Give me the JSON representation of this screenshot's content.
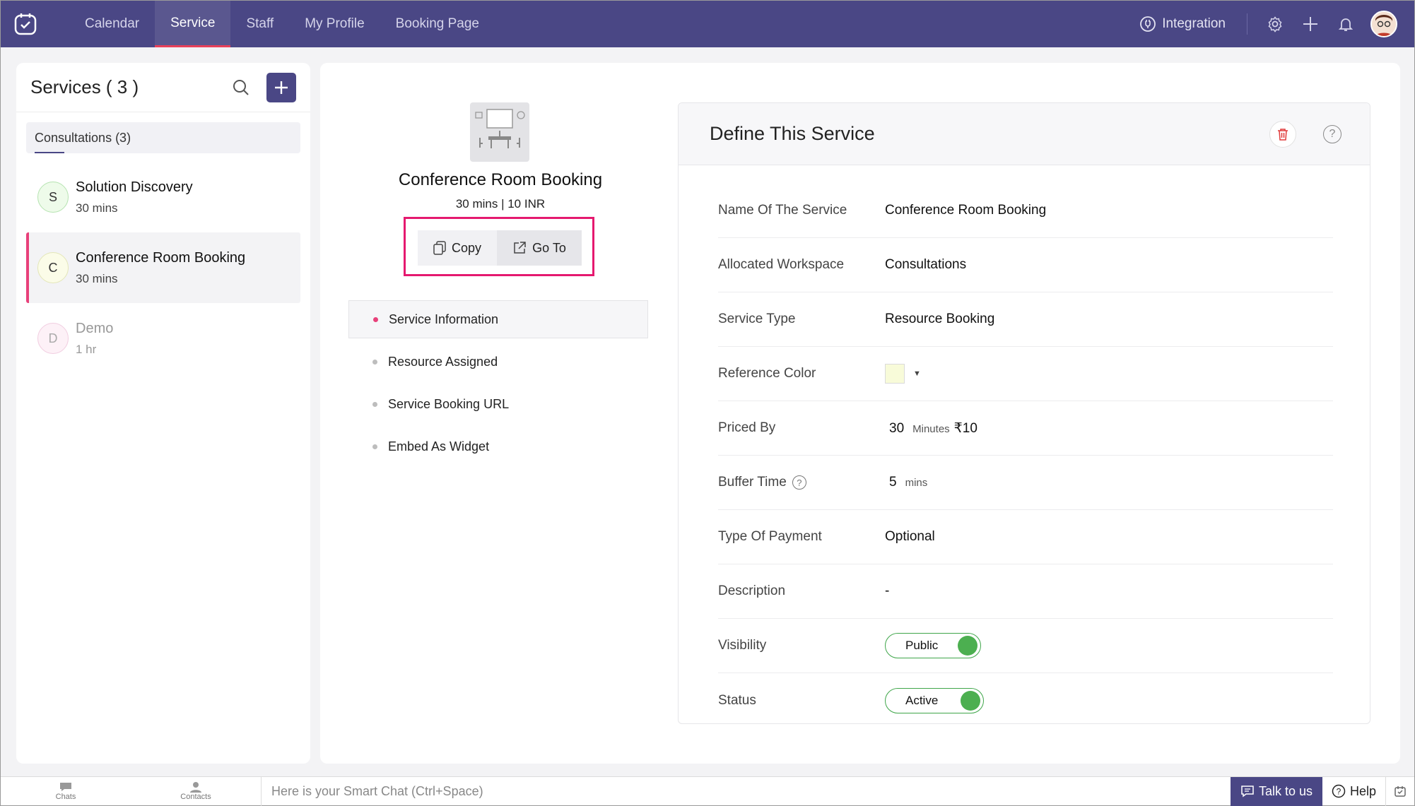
{
  "nav": {
    "tabs": [
      "Calendar",
      "Service",
      "Staff",
      "My Profile",
      "Booking Page"
    ],
    "active_tab": "Service",
    "integration": "Integration"
  },
  "sidebar": {
    "title": "Services ( 3 )",
    "workspace_tab": "Consultations (3)",
    "items": [
      {
        "initial": "S",
        "name": "Solution Discovery",
        "duration": "30 mins"
      },
      {
        "initial": "C",
        "name": "Conference Room Booking",
        "duration": "30 mins"
      },
      {
        "initial": "D",
        "name": "Demo",
        "duration": "1 hr"
      }
    ]
  },
  "service": {
    "title": "Conference Room Booking",
    "meta": "30 mins | 10 INR",
    "copy_label": "Copy",
    "goto_label": "Go To",
    "menu": [
      "Service Information",
      "Resource Assigned",
      "Service Booking URL",
      "Embed As Widget"
    ]
  },
  "define": {
    "title": "Define This Service",
    "fields": {
      "name_label": "Name Of The Service",
      "name_value": "Conference Room Booking",
      "workspace_label": "Allocated Workspace",
      "workspace_value": "Consultations",
      "type_label": "Service Type",
      "type_value": "Resource Booking",
      "color_label": "Reference Color",
      "color_value": "#f8fbd9",
      "priced_label": "Priced By",
      "priced_qty": "30",
      "priced_unit": "Minutes",
      "priced_price": "₹10",
      "buffer_label": "Buffer Time",
      "buffer_qty": "5",
      "buffer_unit": "mins",
      "payment_label": "Type Of Payment",
      "payment_value": "Optional",
      "desc_label": "Description",
      "desc_value": "-",
      "visibility_label": "Visibility",
      "visibility_value": "Public",
      "status_label": "Status",
      "status_value": "Active"
    }
  },
  "bottom": {
    "chats": "Chats",
    "contacts": "Contacts",
    "smart_chat": "Here is your Smart Chat (Ctrl+Space)",
    "talk": "Talk to us",
    "help": "Help"
  },
  "colors": {
    "nav_bg": "#4a4785",
    "accent_pink": "#e8407a",
    "highlight_box": "#e5196f",
    "toggle_green": "#4caf50"
  }
}
